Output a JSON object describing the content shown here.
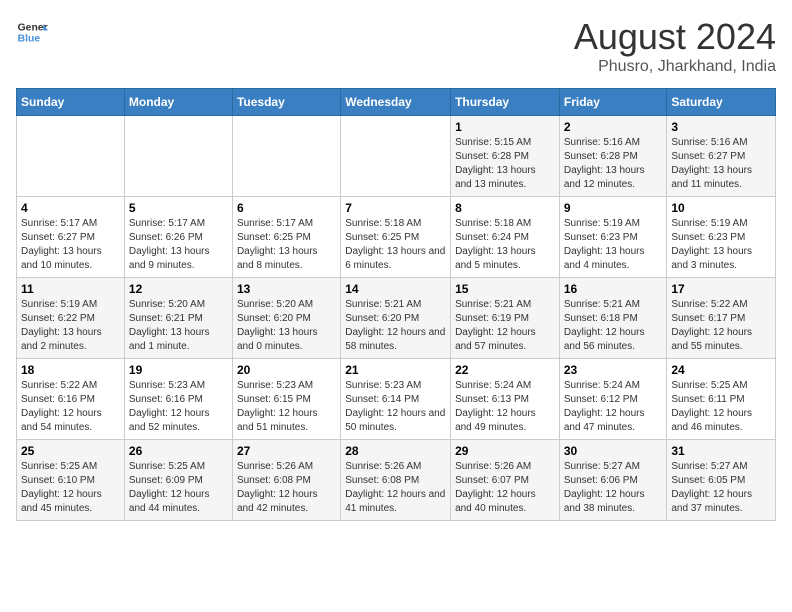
{
  "header": {
    "logo_text_general": "General",
    "logo_text_blue": "Blue",
    "month_title": "August 2024",
    "subtitle": "Phusro, Jharkhand, India"
  },
  "days_of_week": [
    "Sunday",
    "Monday",
    "Tuesday",
    "Wednesday",
    "Thursday",
    "Friday",
    "Saturday"
  ],
  "weeks": [
    [
      {
        "day": "",
        "info": ""
      },
      {
        "day": "",
        "info": ""
      },
      {
        "day": "",
        "info": ""
      },
      {
        "day": "",
        "info": ""
      },
      {
        "day": "1",
        "info": "Sunrise: 5:15 AM\nSunset: 6:28 PM\nDaylight: 13 hours and 13 minutes."
      },
      {
        "day": "2",
        "info": "Sunrise: 5:16 AM\nSunset: 6:28 PM\nDaylight: 13 hours and 12 minutes."
      },
      {
        "day": "3",
        "info": "Sunrise: 5:16 AM\nSunset: 6:27 PM\nDaylight: 13 hours and 11 minutes."
      }
    ],
    [
      {
        "day": "4",
        "info": "Sunrise: 5:17 AM\nSunset: 6:27 PM\nDaylight: 13 hours and 10 minutes."
      },
      {
        "day": "5",
        "info": "Sunrise: 5:17 AM\nSunset: 6:26 PM\nDaylight: 13 hours and 9 minutes."
      },
      {
        "day": "6",
        "info": "Sunrise: 5:17 AM\nSunset: 6:25 PM\nDaylight: 13 hours and 8 minutes."
      },
      {
        "day": "7",
        "info": "Sunrise: 5:18 AM\nSunset: 6:25 PM\nDaylight: 13 hours and 6 minutes."
      },
      {
        "day": "8",
        "info": "Sunrise: 5:18 AM\nSunset: 6:24 PM\nDaylight: 13 hours and 5 minutes."
      },
      {
        "day": "9",
        "info": "Sunrise: 5:19 AM\nSunset: 6:23 PM\nDaylight: 13 hours and 4 minutes."
      },
      {
        "day": "10",
        "info": "Sunrise: 5:19 AM\nSunset: 6:23 PM\nDaylight: 13 hours and 3 minutes."
      }
    ],
    [
      {
        "day": "11",
        "info": "Sunrise: 5:19 AM\nSunset: 6:22 PM\nDaylight: 13 hours and 2 minutes."
      },
      {
        "day": "12",
        "info": "Sunrise: 5:20 AM\nSunset: 6:21 PM\nDaylight: 13 hours and 1 minute."
      },
      {
        "day": "13",
        "info": "Sunrise: 5:20 AM\nSunset: 6:20 PM\nDaylight: 13 hours and 0 minutes."
      },
      {
        "day": "14",
        "info": "Sunrise: 5:21 AM\nSunset: 6:20 PM\nDaylight: 12 hours and 58 minutes."
      },
      {
        "day": "15",
        "info": "Sunrise: 5:21 AM\nSunset: 6:19 PM\nDaylight: 12 hours and 57 minutes."
      },
      {
        "day": "16",
        "info": "Sunrise: 5:21 AM\nSunset: 6:18 PM\nDaylight: 12 hours and 56 minutes."
      },
      {
        "day": "17",
        "info": "Sunrise: 5:22 AM\nSunset: 6:17 PM\nDaylight: 12 hours and 55 minutes."
      }
    ],
    [
      {
        "day": "18",
        "info": "Sunrise: 5:22 AM\nSunset: 6:16 PM\nDaylight: 12 hours and 54 minutes."
      },
      {
        "day": "19",
        "info": "Sunrise: 5:23 AM\nSunset: 6:16 PM\nDaylight: 12 hours and 52 minutes."
      },
      {
        "day": "20",
        "info": "Sunrise: 5:23 AM\nSunset: 6:15 PM\nDaylight: 12 hours and 51 minutes."
      },
      {
        "day": "21",
        "info": "Sunrise: 5:23 AM\nSunset: 6:14 PM\nDaylight: 12 hours and 50 minutes."
      },
      {
        "day": "22",
        "info": "Sunrise: 5:24 AM\nSunset: 6:13 PM\nDaylight: 12 hours and 49 minutes."
      },
      {
        "day": "23",
        "info": "Sunrise: 5:24 AM\nSunset: 6:12 PM\nDaylight: 12 hours and 47 minutes."
      },
      {
        "day": "24",
        "info": "Sunrise: 5:25 AM\nSunset: 6:11 PM\nDaylight: 12 hours and 46 minutes."
      }
    ],
    [
      {
        "day": "25",
        "info": "Sunrise: 5:25 AM\nSunset: 6:10 PM\nDaylight: 12 hours and 45 minutes."
      },
      {
        "day": "26",
        "info": "Sunrise: 5:25 AM\nSunset: 6:09 PM\nDaylight: 12 hours and 44 minutes."
      },
      {
        "day": "27",
        "info": "Sunrise: 5:26 AM\nSunset: 6:08 PM\nDaylight: 12 hours and 42 minutes."
      },
      {
        "day": "28",
        "info": "Sunrise: 5:26 AM\nSunset: 6:08 PM\nDaylight: 12 hours and 41 minutes."
      },
      {
        "day": "29",
        "info": "Sunrise: 5:26 AM\nSunset: 6:07 PM\nDaylight: 12 hours and 40 minutes."
      },
      {
        "day": "30",
        "info": "Sunrise: 5:27 AM\nSunset: 6:06 PM\nDaylight: 12 hours and 38 minutes."
      },
      {
        "day": "31",
        "info": "Sunrise: 5:27 AM\nSunset: 6:05 PM\nDaylight: 12 hours and 37 minutes."
      }
    ]
  ]
}
